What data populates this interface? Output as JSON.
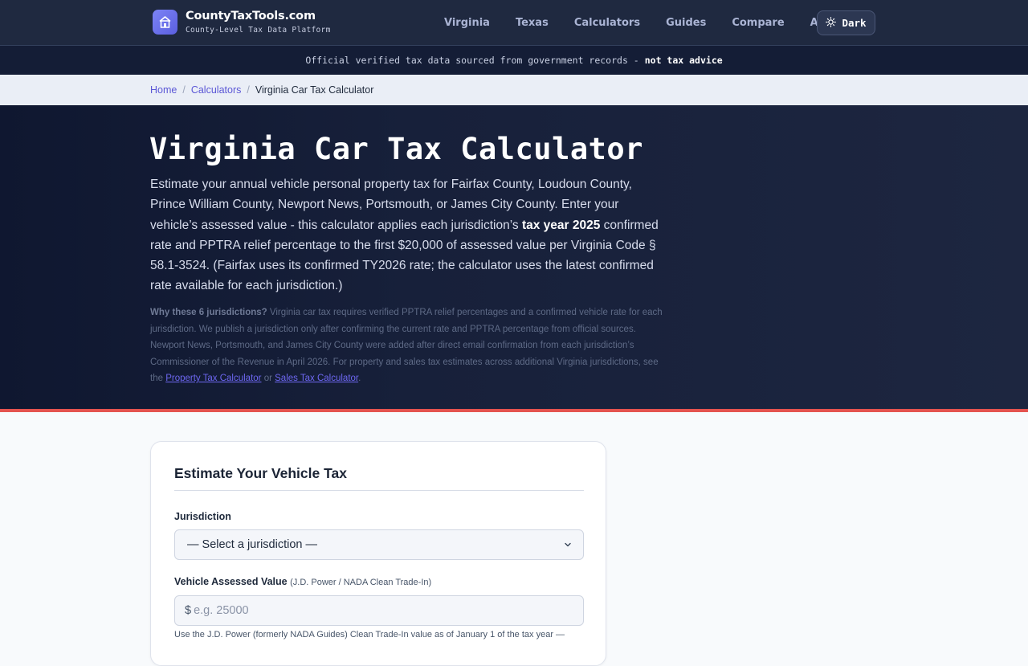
{
  "header": {
    "brand_name": "CountyTaxTools.com",
    "brand_tagline": "County-Level Tax Data Platform",
    "nav": [
      "Virginia",
      "Texas",
      "Calculators",
      "Guides",
      "Compare",
      "About"
    ],
    "theme_toggle": "Dark"
  },
  "notice": {
    "text": "Official verified tax data sourced from government records -",
    "emphasis": "not tax advice"
  },
  "breadcrumb": {
    "home": "Home",
    "calculators": "Calculators",
    "current": "Virginia Car Tax Calculator",
    "separator": "/"
  },
  "hero": {
    "title": "Virginia Car Tax Calculator",
    "lead_1": "Estimate your annual vehicle personal property tax for Fairfax County, Loudoun County, Prince William County, Newport News, Portsmouth, or James City County. Enter your vehicle’s assessed value - this calculator applies each jurisdiction’s ",
    "lead_bold": "tax year 2025",
    "lead_2": " confirmed rate and PPTRA relief percentage to the first $20,000 of assessed value per Virginia Code § 58.1-3524. (Fairfax uses its confirmed TY2026 rate; the calculator uses the latest confirmed rate available for each jurisdiction.)",
    "why_label": "Why these 6 jurisdictions?",
    "why_text": " Virginia car tax requires verified PPTRA relief percentages and a confirmed vehicle rate for each jurisdiction. We publish a jurisdiction only after confirming the current rate and PPTRA percentage from official sources. Newport News, Portsmouth, and James City County were added after direct email confirmation from each jurisdiction’s Commissioner of the Revenue in April 2026. For property and sales tax estimates across additional Virginia jurisdictions, see the ",
    "link_property": "Property Tax Calculator",
    "why_or": " or ",
    "link_sales": "Sales Tax Calculator",
    "why_end": "."
  },
  "form": {
    "title": "Estimate Your Vehicle Tax",
    "jurisdiction_label": "Jurisdiction",
    "jurisdiction_value": "— Select a jurisdiction —",
    "value_label": "Vehicle Assessed Value",
    "value_hint": "(J.D. Power / NADA Clean Trade-In)",
    "currency": "$",
    "value_placeholder": "e.g. 25000",
    "help_text": "Use the J.D. Power (formerly NADA Guides) Clean Trade-In value as of January 1 of the tax year —"
  },
  "colors": {
    "header_bg": "#1f2940",
    "hero_bg": "#0f1730",
    "accent": "#5b57d6",
    "divider_red": "#e4534f"
  },
  "icons": {
    "logo": "house-building-icon",
    "theme": "sun-icon",
    "select": "chevron-down-icon"
  }
}
